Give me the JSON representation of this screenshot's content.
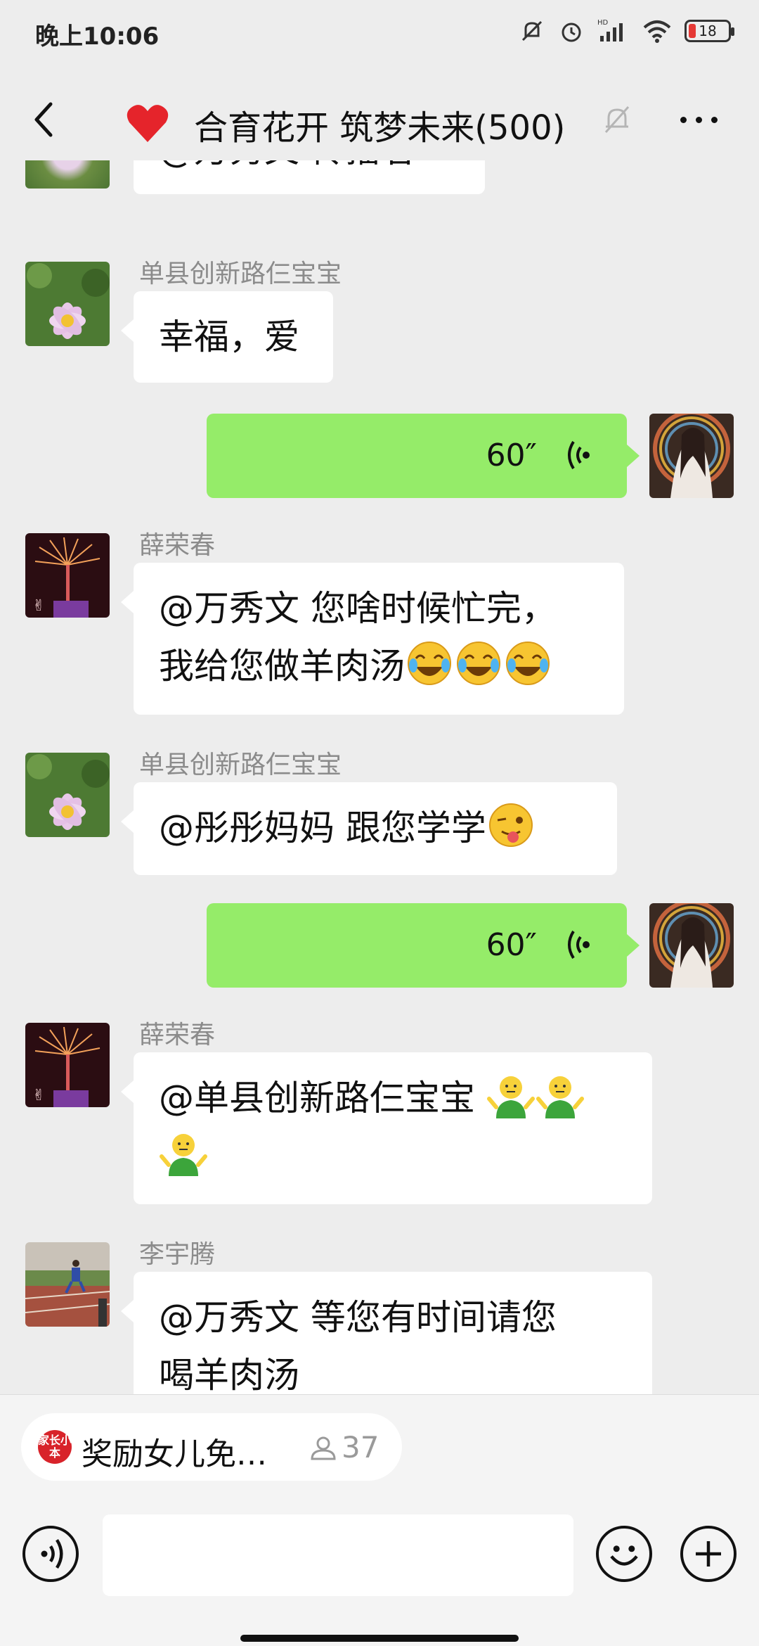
{
  "status_bar": {
    "time": "晚上10:06",
    "battery": "18"
  },
  "header": {
    "title": "合育花开 筑梦未来(500)"
  },
  "messages": [
    {
      "type": "text",
      "side": "left",
      "text": "@万秀文  传播者"
    },
    {
      "type": "text",
      "side": "left",
      "sender": "单县创新路仨宝宝",
      "text": "幸福，爱"
    },
    {
      "type": "voice",
      "side": "right",
      "duration": "60″"
    },
    {
      "type": "text",
      "side": "left",
      "sender": "薛荣春",
      "line1": "@万秀文  您啥时候忙完，",
      "line2": "我给您做羊肉汤",
      "emojis": [
        "face-with-tears-of-joy",
        "face-with-tears-of-joy",
        "face-with-tears-of-joy"
      ]
    },
    {
      "type": "text",
      "side": "left",
      "sender": "单县创新路仨宝宝",
      "text": "@彤彤妈妈  跟您学学",
      "emojis": [
        "winking-face-with-tongue"
      ]
    },
    {
      "type": "voice",
      "side": "right",
      "duration": "60″"
    },
    {
      "type": "text",
      "side": "left",
      "sender": "薛荣春",
      "text": "@单县创新路仨宝宝",
      "emojis": [
        "shrug",
        "shrug",
        "shrug"
      ]
    },
    {
      "type": "text",
      "side": "left",
      "sender": "李宇腾",
      "line1": "@万秀文  等您有时间请您",
      "line2": "喝羊肉汤"
    }
  ],
  "mini_app": {
    "logo_text": "家长小本",
    "label": "奖励女儿免…",
    "count": "37"
  },
  "colors": {
    "background": "#ededed",
    "self_bubble": "#95ec69",
    "other_bubble": "#ffffff",
    "heart": "#e5242b"
  }
}
